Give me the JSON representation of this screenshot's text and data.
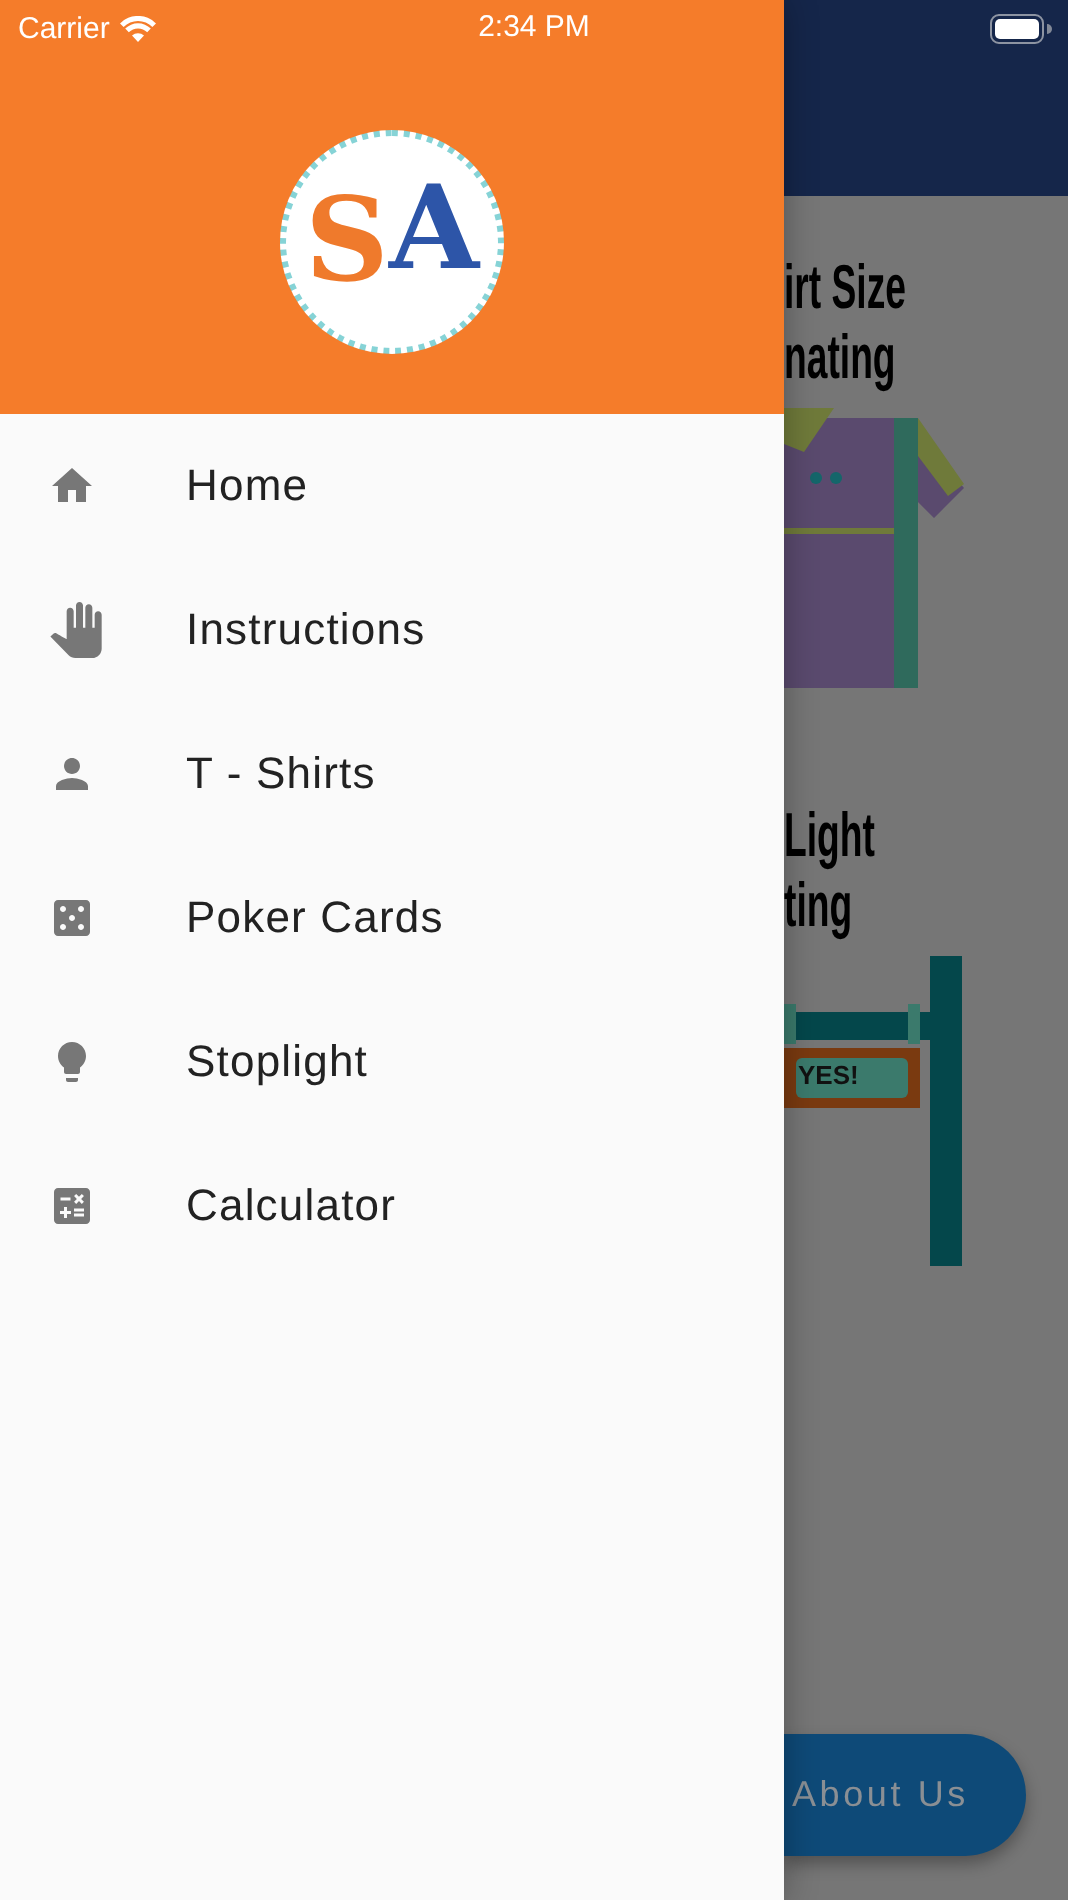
{
  "status_bar": {
    "carrier": "Carrier",
    "time": "2:34 PM"
  },
  "drawer": {
    "logo": {
      "letters": [
        "S",
        "A"
      ]
    },
    "items": [
      {
        "kind": "home",
        "label": "Home"
      },
      {
        "kind": "hand",
        "label": "Instructions"
      },
      {
        "kind": "person",
        "label": "T - Shirts"
      },
      {
        "kind": "dice",
        "label": "Poker Cards"
      },
      {
        "kind": "bulb",
        "label": "Stoplight"
      },
      {
        "kind": "calculator",
        "label": "Calculator"
      }
    ]
  },
  "background": {
    "cards": [
      {
        "kind": "shirt",
        "title_lines": [
          "irt Size",
          "nating"
        ]
      },
      {
        "kind": "stoplight",
        "title_lines": [
          "Light",
          "ting"
        ],
        "sign_text": "YES!"
      }
    ],
    "about_button": "About Us"
  }
}
